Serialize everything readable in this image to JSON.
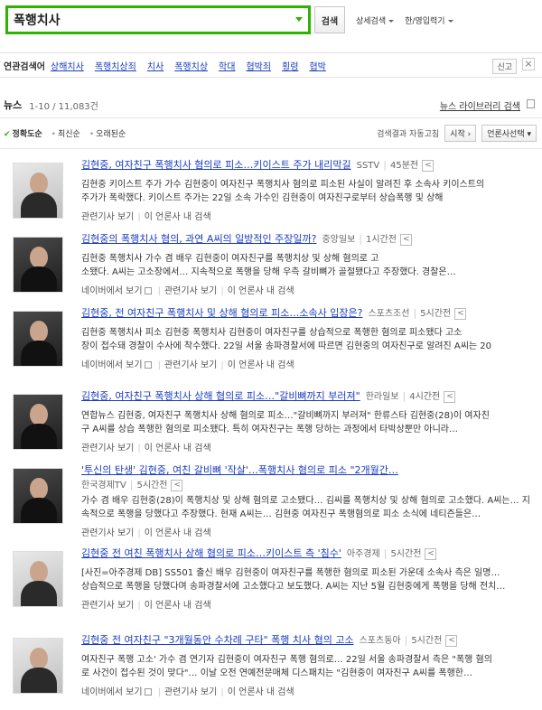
{
  "search": {
    "query": "폭행치사",
    "button": "검색",
    "advanced": "상세검색",
    "lang": "한/영입력기"
  },
  "related": {
    "label": "연관검색어",
    "keywords": [
      "상해치사",
      "폭행치상죄",
      "치사",
      "폭행치상",
      "학대",
      "협박죄",
      "횡령",
      "협박"
    ],
    "report": "신고",
    "close": "×"
  },
  "news": {
    "title": "뉴스",
    "count": "1-10 / 11,083건",
    "library": "뉴스 라이브러리 검색"
  },
  "sort": {
    "options": [
      "정확도순",
      "최신순",
      "오래된순"
    ],
    "auto_label": "검색결과 자동고침",
    "start_btn": "시작",
    "press_btn": "언론사선택"
  },
  "items": [
    {
      "title": "김현중, 여자친구 폭행치사 혐의로 피소…키이스트 주가 내리막길",
      "press": "SSTV",
      "time": "45분전",
      "desc": [
        "김현중 키이스트 주가 가수 김현중이 여자친구 폭행치사 혐의로 피소된 사실이 알려진 후 소속사 키이스트의",
        "주가가 폭락했다. 키이스트 주가는 22일 소속 가수인 김현중이 여자친구로부터 상습폭행 및 상해"
      ],
      "links": [
        "관련기사 보기",
        "이 언론사 내 검색"
      ]
    },
    {
      "title": "김현중의 폭행치사 혐의, 과연 A씨의 일방적인 주장일까?",
      "press": "중앙일보",
      "time": "1시간전",
      "desc": [
        "김현중 폭행치사 가수 겸 배우 김현중이 여자친구를 폭행치상 및 상해 혐의로 고",
        "소됐다. A씨는 고소장에서… 지속적으로 폭행을 당해 우측 갈비뼈가 골절됐다고 주장했다. 경찰은…"
      ],
      "links": [
        "네이버에서 보기",
        "관련기사 보기",
        "이 언론사 내 검색"
      ]
    },
    {
      "title": "김현중, 전 여자친구 폭행치사 및 상해 혐의로 피소…소속사 입장은?",
      "press": "스포츠조선",
      "time": "5시간전",
      "desc": [
        "김현중 폭행치사 피소 김현중 폭행치사 김현중이 여자친구를 상습적으로 폭행한 혐의로 피소됐다 고소",
        "장이 접수돼 경찰이 수사에 착수했다. 22일 서울 송파경찰서에 따르면 김현중의 여자친구로 알려진 A씨는 20"
      ],
      "links": [
        "네이버에서 보기",
        "관련기사 보기",
        "이 언론사 내 검색"
      ]
    },
    {
      "title": "김현중, 여자친구 폭행치사 상해 혐의로 피소…\"갈비뼈까지 부러져\"",
      "press": "한라일보",
      "time": "4시간전",
      "desc": [
        "연합뉴스 김현중, 여자친구 폭행치사 상해 혐의로 피소…\"갈비뼈까지 부러져\" 한류스타 김현중(28)이 여자친",
        "구 A씨를 상습 폭행한 혐의로 피소됐다. 특히 여자친구는 폭행 당하는 과정에서 타박상뿐만 아니라…"
      ],
      "links": [
        "관련기사 보기",
        "이 언론사 내 검색"
      ]
    },
    {
      "title": "'투신의 탄생' 김현중, 여친 갈비뼈 '작살'…폭행치사 혐의로 피소 \"2개월간…",
      "press": "한국경제TV",
      "time": "5시간전",
      "desc": [
        "가수 겸 배우 김현중(28)이 폭행치상 및 상해 혐의로 고소됐다… 김씨를 폭행치상 및 상해 혐의로 고소했다. A씨는… 지",
        "속적으로 폭행을 당했다고 주장했다. 현재 A씨는… 김현중 여자친구 폭행혐의로 피소 소식에 네티즌들은…"
      ],
      "links": [
        "관련기사 보기",
        "이 언론사 내 검색"
      ]
    },
    {
      "title": "김현중 전 여친 폭행치사 상해 혐의로 피소…키이스트 측 '침수'",
      "press": "아주경제",
      "time": "5시간전",
      "desc": [
        "[사진=아주경제 DB] SS501 출신 배우 김현중이 여자친구를 폭행한 혐의로 피소된 가운데 소속사 측은 일명…",
        "상습적으로 폭행을 당했다며 송파경찰서에 고소했다고 보도했다. A씨는 지난 5월 김현중에게 폭행을 당해 전치…"
      ],
      "links": [
        "관련기사 보기",
        "이 언론사 내 검색"
      ]
    },
    {
      "title": "김현중 전 여자친구 \"3개월동안 수차례 구타\" 폭행 치사 혐의 고소",
      "press": "스포츠동아",
      "time": "5시간전",
      "desc": [
        "여자친구 폭행 고소' 가수 겸 연기자 김현중이 여자친구 폭행 혐의로… 22일 서울 송파경찰서 측은 \"폭행 혐의",
        "로 사건이 접수된 것이 맞다\"… 이날 오전 연예전문매체 디스패치는 \"김현중이 여자친구 A씨를 폭행한…"
      ],
      "links": [
        "네이버에서 보기",
        "관련기사 보기",
        "이 언론사 내 검색"
      ]
    }
  ]
}
